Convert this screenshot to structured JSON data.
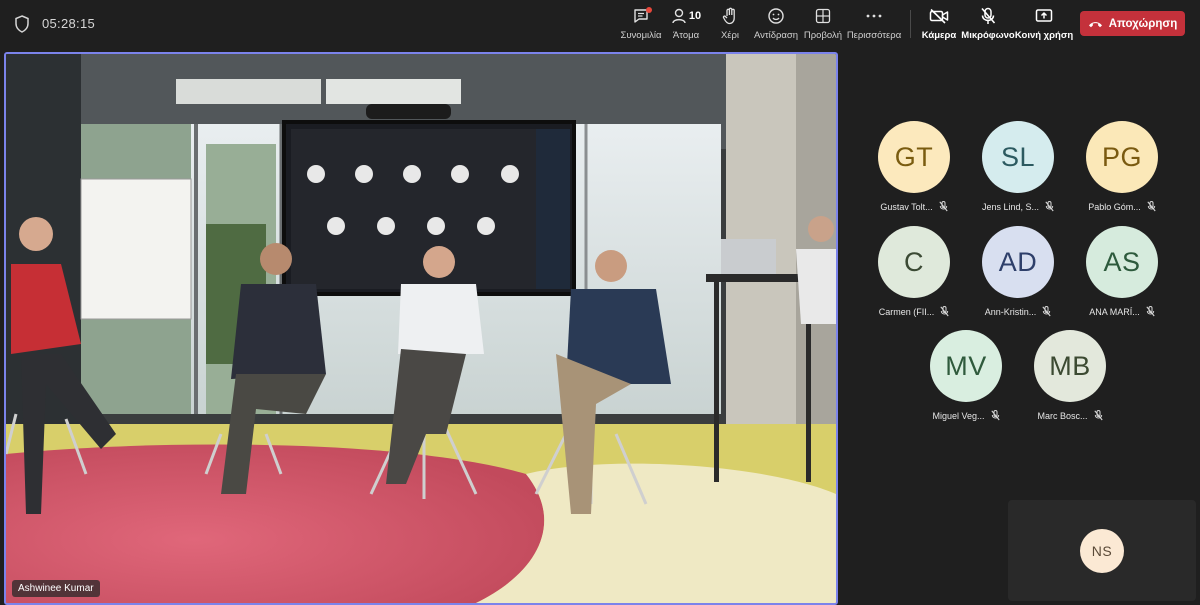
{
  "timer": "05:28:15",
  "toolbar": {
    "chat": "Συνομιλία",
    "people": "Άτομα",
    "people_count": "10",
    "hand": "Χέρι",
    "react": "Αντίδραση",
    "view": "Προβολή",
    "more": "Περισσότερα",
    "camera": "Κάμερα",
    "mic": "Μικρόφωνο",
    "share": "Κοινή χρήση",
    "leave": "Αποχώρηση"
  },
  "main_video": {
    "speaker_name": "Ashwinee Kumar"
  },
  "participants": [
    {
      "initials": "GT",
      "name": "Gustav Tolt...",
      "bg": "#fce9bd",
      "fg": "#7a5c10"
    },
    {
      "initials": "SL",
      "name": "Jens Lind, S...",
      "bg": "#d5ecee",
      "fg": "#2c5a60"
    },
    {
      "initials": "PG",
      "name": "Pablo Góm...",
      "bg": "#fbe8b8",
      "fg": "#7a5a10"
    },
    {
      "initials": "C",
      "name": "Carmen (FII...",
      "bg": "#dfe9db",
      "fg": "#3b4a34"
    },
    {
      "initials": "AD",
      "name": "Ann-Kristin...",
      "bg": "#d8dff0",
      "fg": "#2e3f6a"
    },
    {
      "initials": "AS",
      "name": "ANA MARÍ...",
      "bg": "#d6ebdd",
      "fg": "#2d5a3c"
    },
    {
      "initials": "MV",
      "name": "Miguel Veg...",
      "bg": "#d9eee0",
      "fg": "#2f5a3c"
    },
    {
      "initials": "MB",
      "name": "Marc Bosc...",
      "bg": "#e3e8dc",
      "fg": "#3c4a32"
    }
  ],
  "self_view": {
    "initials": "NS"
  },
  "colors": {
    "accent": "#7b83eb",
    "leave": "#c4313b"
  }
}
